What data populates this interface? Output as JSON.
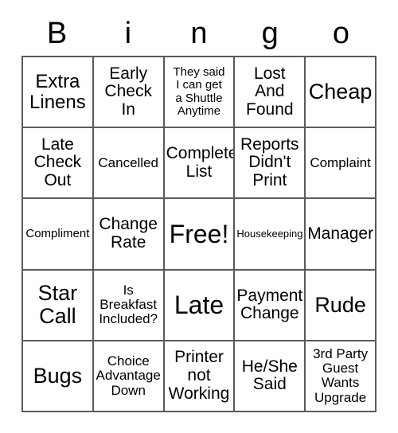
{
  "card": {
    "header_letters": [
      "B",
      "i",
      "n",
      "g",
      "o"
    ],
    "colors": {
      "border": "#5a5a5a",
      "background": "#ffffff",
      "text": "#000000"
    },
    "rows": [
      [
        {
          "label": "Extra\nLinens",
          "size": "lg"
        },
        {
          "label": "Early\nCheck\nIn",
          "size": "md"
        },
        {
          "label": "They said\nI can get\na Shuttle\nAnytime",
          "size": "xs"
        },
        {
          "label": "Lost\nAnd\nFound",
          "size": "md"
        },
        {
          "label": "Cheap",
          "size": "xl"
        }
      ],
      [
        {
          "label": "Late\nCheck\nOut",
          "size": "md"
        },
        {
          "label": "Cancelled",
          "size": "sm"
        },
        {
          "label": "Complete\nList",
          "size": "md"
        },
        {
          "label": "Reports\nDidn't\nPrint",
          "size": "md"
        },
        {
          "label": "Complaint",
          "size": "sm"
        }
      ],
      [
        {
          "label": "Compliment",
          "size": "xs"
        },
        {
          "label": "Change\nRate",
          "size": "md"
        },
        {
          "label": "Free!",
          "size": "xxl"
        },
        {
          "label": "Housekeeping",
          "size": "xxs"
        },
        {
          "label": "Manager",
          "size": "md"
        }
      ],
      [
        {
          "label": "Star\nCall",
          "size": "xl"
        },
        {
          "label": "Is\nBreakfast\nIncluded?",
          "size": "sm"
        },
        {
          "label": "Late",
          "size": "xxl"
        },
        {
          "label": "Payment\nChange",
          "size": "md"
        },
        {
          "label": "Rude",
          "size": "xl"
        }
      ],
      [
        {
          "label": "Bugs",
          "size": "xl"
        },
        {
          "label": "Choice\nAdvantage\nDown",
          "size": "sm"
        },
        {
          "label": "Printer\nnot\nWorking",
          "size": "md"
        },
        {
          "label": "He/She\nSaid",
          "size": "md"
        },
        {
          "label": "3rd Party\nGuest\nWants\nUpgrade",
          "size": "sm"
        }
      ]
    ]
  }
}
